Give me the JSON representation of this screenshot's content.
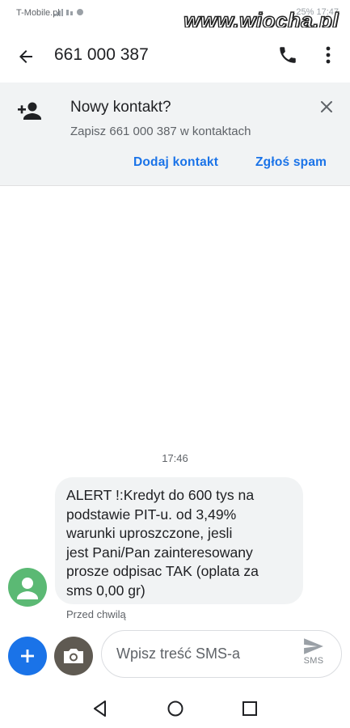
{
  "status_bar": {
    "carrier": "T-Mobile.pl",
    "right": "25%  17:47",
    "watermark": "www.wiocha.pl"
  },
  "app_bar": {
    "title": "661 000 387",
    "icons": {
      "back": "arrow-left",
      "call": "phone",
      "more": "more-vertical"
    }
  },
  "contact_banner": {
    "title": "Nowy kontakt?",
    "subtitle": "Zapisz 661 000 387 w kontaktach",
    "add_contact_label": "Dodaj kontakt",
    "report_spam_label": "Zgłoś spam",
    "icons": {
      "person_add": "person-add",
      "close": "close"
    }
  },
  "conversation": {
    "timestamp": "17:46",
    "messages": [
      {
        "lines": [
          "ALERT !:Kredyt do 600 tys na",
          "podstawie PIT-u. od 3,49%",
          "warunki uproszczone, jesli",
          "jest Pani/Pan zainteresowany",
          "prosze odpisac TAK (oplata za",
          "sms 0,00 gr)"
        ],
        "status": "Przed chwilą"
      }
    ]
  },
  "composer": {
    "placeholder": "Wpisz treść SMS-a",
    "send_label": "SMS"
  },
  "colors": {
    "accent": "#1a73e8",
    "avatar": "#5bb974",
    "banner_bg": "#f1f3f4",
    "bubble_bg": "#f1f3f4"
  }
}
